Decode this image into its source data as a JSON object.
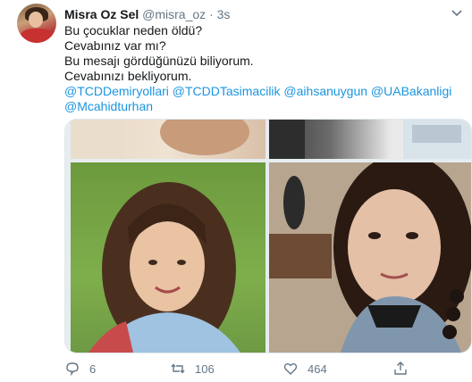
{
  "tweet": {
    "name": "Misra Oz Sel",
    "handle": "@misra_oz",
    "separator": "·",
    "time": "3s",
    "lines": [
      "Bu çocuklar neden öldü?",
      "Cevabınız var mı?",
      "Bu mesajı gördüğünüzü biliyorum.",
      "Cevabınızı bekliyorum."
    ],
    "mentions_line1": "@TCDDemiryollari @TCDDTasimacilik @aihsanuygun @UABakanligi",
    "mentions_line2": " @Mcahidturhan",
    "actions": {
      "replies": "6",
      "retweets": "106",
      "likes": "464"
    }
  },
  "icons": [
    "chevron-down-icon",
    "reply-icon",
    "retweet-icon",
    "like-icon",
    "share-icon"
  ],
  "colors": {
    "link": "#1b95e0",
    "muted": "#657786",
    "text": "#14171a"
  }
}
